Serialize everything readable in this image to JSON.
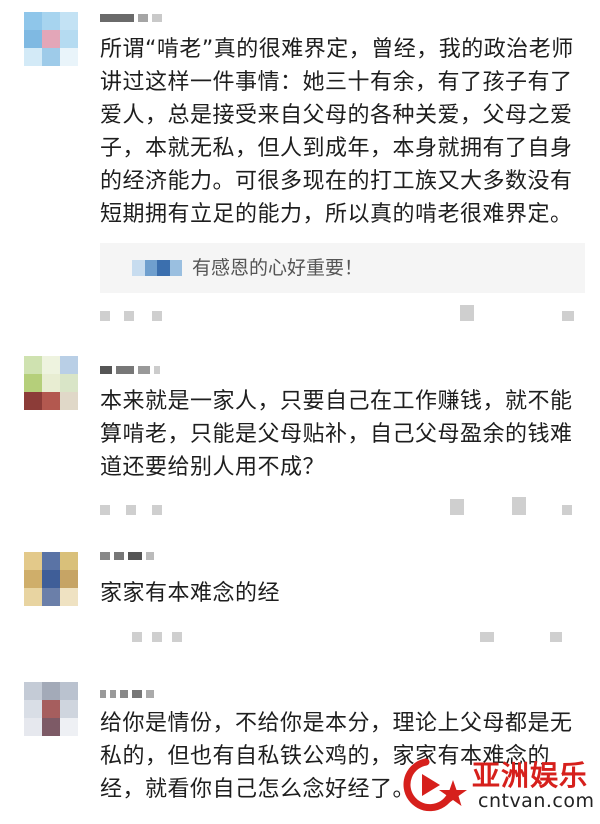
{
  "comments": [
    {
      "text": "所谓“啃老”真的很难界定，曾经，我的政治老师讲过这样一件事情：她三十有余，有了孩子有了爱人，总是接受来自父母的各种关爱，父母之爱子，本就无私，但人到成年，本身就拥有了自身的经济能力。可很多现在的打工族又大多数没有短期拥有立足的能力，所以真的啃老很难界定。",
      "reply": "有感恩的心好重要！"
    },
    {
      "text": "本来就是一家人，只要自己在工作赚钱，就不能算啃老，只能是父母贴补，自己父母盈余的钱难道还要给别人用不成？"
    },
    {
      "text": "家家有本难念的经"
    },
    {
      "text": "给你是情份，不给你是本分，理论上父母都是无私的，但也有自私铁公鸡的，家家有本难念的经，就看你自己怎么念好经了。"
    }
  ],
  "watermark": {
    "name_cn": "亚洲娱乐",
    "domain": "cntvan.com",
    "brand_color": "#d6201c"
  }
}
